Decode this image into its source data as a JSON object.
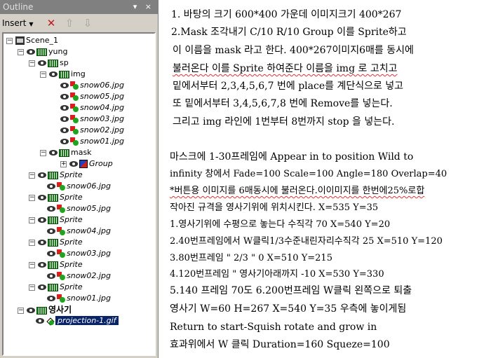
{
  "outline_panel": {
    "title": "Outline",
    "window_buttons": "▾ ×",
    "insert_label": "Insert",
    "tree": [
      {
        "label": "Scene_1",
        "type": "scene",
        "expanded": true
      },
      {
        "label": "yung",
        "type": "layer",
        "expanded": true
      },
      {
        "label": "sp",
        "type": "layer",
        "expanded": true
      },
      {
        "label": "img",
        "type": "layer",
        "expanded": true
      },
      {
        "label": "snow06.jpg",
        "type": "file"
      },
      {
        "label": "snow05.jpg",
        "type": "file"
      },
      {
        "label": "snow04.jpg",
        "type": "file"
      },
      {
        "label": "snow03.jpg",
        "type": "file"
      },
      {
        "label": "snow02.jpg",
        "type": "file"
      },
      {
        "label": "snow01.jpg",
        "type": "file"
      },
      {
        "label": "mask",
        "type": "layer",
        "expanded": true
      },
      {
        "label": "Group",
        "type": "group",
        "expanded": false
      },
      {
        "label": "Sprite",
        "type": "sprite"
      },
      {
        "label": "snow06.jpg",
        "type": "file"
      },
      {
        "label": "Sprite",
        "type": "sprite"
      },
      {
        "label": "snow05.jpg",
        "type": "file"
      },
      {
        "label": "Sprite",
        "type": "sprite"
      },
      {
        "label": "snow04.jpg",
        "type": "file"
      },
      {
        "label": "Sprite",
        "type": "sprite"
      },
      {
        "label": "snow03.jpg",
        "type": "file"
      },
      {
        "label": "Sprite",
        "type": "sprite"
      },
      {
        "label": "snow02.jpg",
        "type": "file"
      },
      {
        "label": "Sprite",
        "type": "sprite"
      },
      {
        "label": "snow01.jpg",
        "type": "file"
      },
      {
        "label": "영사기",
        "type": "layer",
        "expanded": true
      },
      {
        "label": "projection-1.gif",
        "type": "file",
        "selected": true
      }
    ]
  },
  "notes": {
    "lines": [
      "1. 바탕의 크기 600*400 가운데 이미지크기 400*267",
      "2.Mask 조각내기 C/10 R/10 Group 이를 Sprite하고",
      " 이 이름을 mask 라고 한다. 400*267이미지6매를 동시에",
      " 불러온다 이를 Sprite 하여준다 이름을 img 로 고치고",
      " 밑에서부터 2,3,4,5,6,7 번에 place를 계단식으로 넣고",
      " 또 밑에서부터 3,4,5,6,7,8 번에 Remove를 넣는다.",
      " 그리고 img 라인에 1번부터 8번까지 stop 을 넣는다.",
      "마스크에 1-30프레임에 Appear in to position Wild to",
      "infinity 창에서 Fade=100 Scale=100 Angle=180 Overlap=40",
      "*버튼용 이미지를 6매동시에 불러온다.이이미지를 한번에25%로합",
      "작아진 규격을 영사기위에 위치시킨다. X=535 Y=35",
      "1.영사기위에 수평으로 놓는다    수직각 70 X=540 Y=20",
      "2.40번프레임에서 W클릭1/3수준내린자리수직각 25 X=510 Y=120",
      "3.80번프레임      \"      2/3      \"          0  X=510 Y=215",
      "4.120번프레임      \"      영사기아래까지       -10 X=530 Y=330",
      "5.140 프레임 70도 6.200번프레임 W클릭 왼쪽으로 퇴출",
      "영사기 W=60 H=267 X=540 Y=35 우측에 놓이게됨",
      "Return to start-Squish rotate and grow in",
      "효과위에서 W 클릭 Duration=160 Squeze=100"
    ]
  }
}
